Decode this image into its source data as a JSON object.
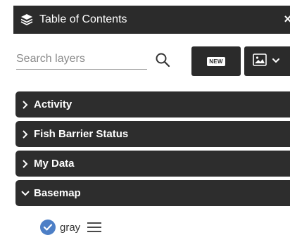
{
  "panel": {
    "title": "Table of Contents",
    "close_symbol": "×",
    "header_icon": "layers-icon"
  },
  "search": {
    "placeholder": "Search layers",
    "value": "",
    "icon": "search-icon"
  },
  "toolbar": {
    "new_label": "NEW",
    "basemap_icon": "image-icon",
    "basemap_dropdown_icon": "chevron-down-icon"
  },
  "groups": [
    {
      "label": "Activity",
      "expanded": false
    },
    {
      "label": "Fish Barrier Status",
      "expanded": false
    },
    {
      "label": "My Data",
      "expanded": false
    },
    {
      "label": "Basemap",
      "expanded": true
    }
  ],
  "basemap_layers": [
    {
      "label": "gray",
      "checked": true
    }
  ],
  "colors": {
    "header_bg": "#2b2b2b",
    "group_bg": "#2d2d2d",
    "check_blue": "#4d7fc6"
  }
}
